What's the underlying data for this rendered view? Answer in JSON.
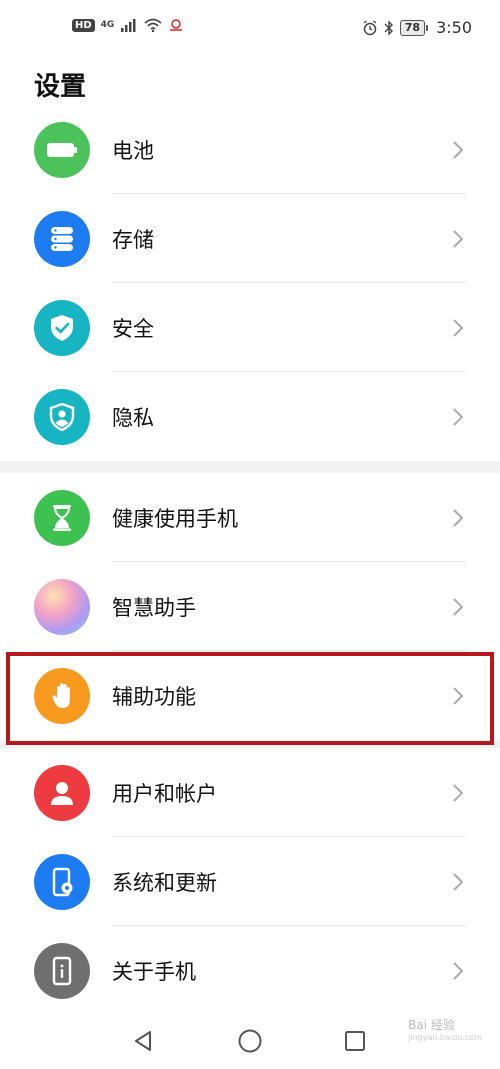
{
  "status_bar": {
    "hd": "HD",
    "network": "4G",
    "time": "3:50",
    "battery_level": "78",
    "icons": [
      "hd-icon",
      "signal-icon",
      "wifi-icon",
      "carrier-icon",
      "alarm-icon",
      "bluetooth-icon",
      "battery-icon"
    ]
  },
  "page": {
    "title": "设置"
  },
  "settings": {
    "items": [
      {
        "label": "电池",
        "icon": "battery-icon",
        "color": "#4CC25A"
      },
      {
        "label": "存储",
        "icon": "storage-icon",
        "color": "#1E7CF2"
      },
      {
        "label": "安全",
        "icon": "shield-check-icon",
        "color": "#17B5C4"
      },
      {
        "label": "隐私",
        "icon": "privacy-shield-icon",
        "color": "#17B5C4"
      },
      {
        "label": "健康使用手机",
        "icon": "hourglass-icon",
        "color": "#3DC251"
      },
      {
        "label": "智慧助手",
        "icon": "assistant-orb-icon",
        "color": "#C9A6F0"
      },
      {
        "label": "辅助功能",
        "icon": "hand-icon",
        "color": "#F79A1E"
      },
      {
        "label": "用户和帐户",
        "icon": "user-icon",
        "color": "#EE3B3F"
      },
      {
        "label": "系统和更新",
        "icon": "phone-settings-icon",
        "color": "#1E7CF2"
      },
      {
        "label": "关于手机",
        "icon": "phone-info-icon",
        "color": "#6F6F6F"
      }
    ]
  },
  "highlight": {
    "target": "辅助功能",
    "color": "#B3191E"
  },
  "nav_bar": {
    "buttons": [
      "back-icon",
      "home-icon",
      "recents-icon"
    ]
  },
  "watermark": {
    "text": "Bai 经验",
    "sub": "jingyan.baidu.com"
  }
}
